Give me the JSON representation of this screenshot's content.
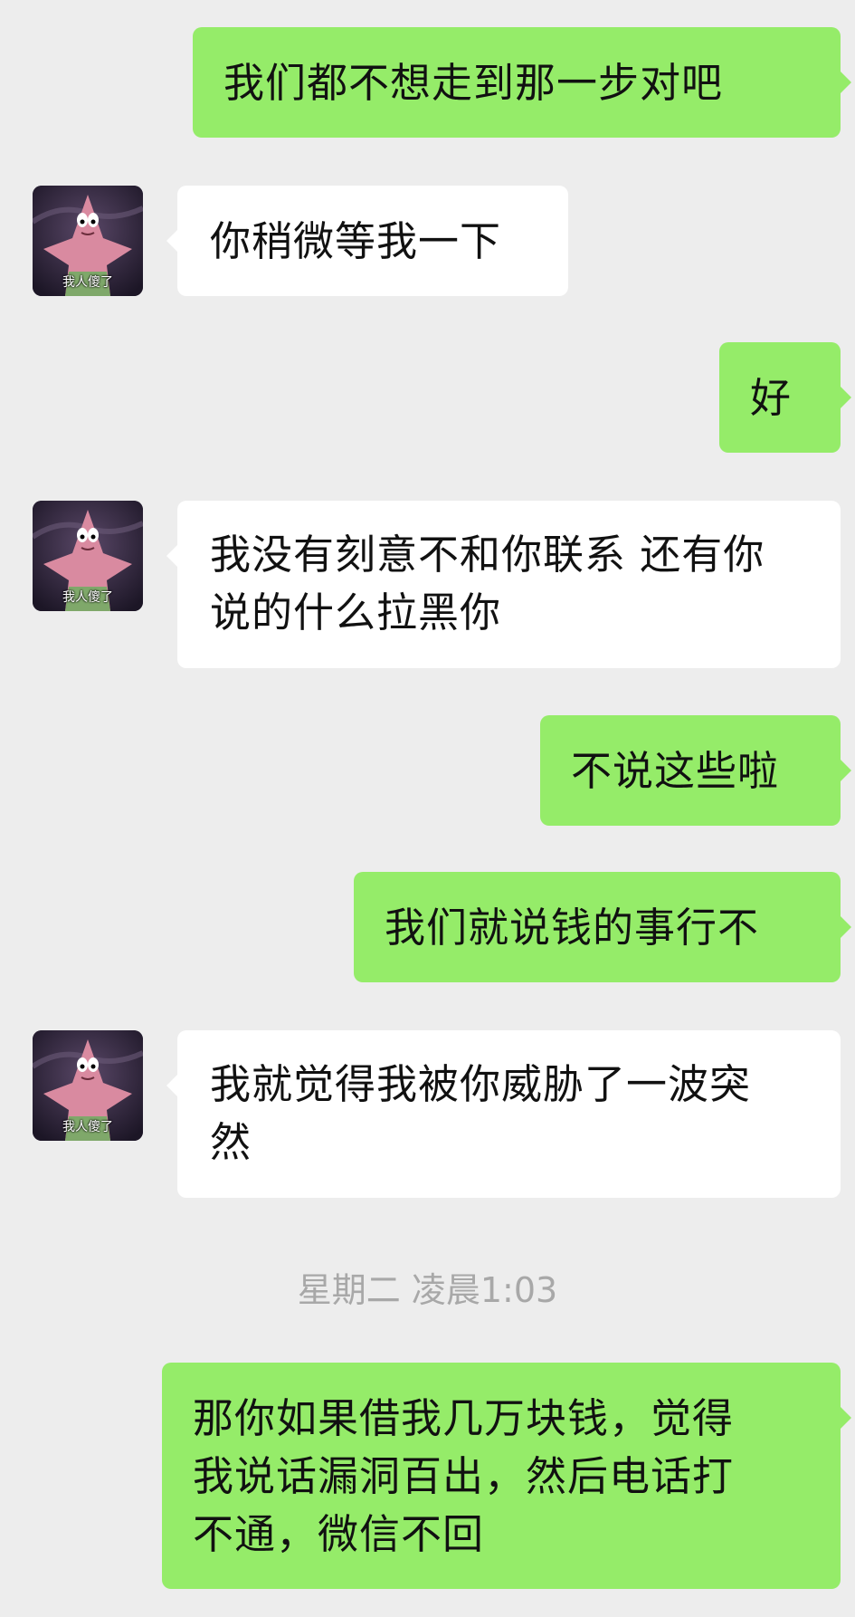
{
  "contact": {
    "avatar_caption": "我人傻了",
    "avatar_icon": "patrick-star-avatar-icon"
  },
  "messages": [
    {
      "side": "out",
      "text": "我们都不想走到那一步对吧"
    },
    {
      "side": "in",
      "text": "你稍微等我一下"
    },
    {
      "side": "out",
      "text": "好"
    },
    {
      "side": "in",
      "lines": [
        "我没有刻意不和你联系 还有你",
        "说的什么拉黑你"
      ]
    },
    {
      "side": "out",
      "text": "不说这些啦"
    },
    {
      "side": "out",
      "text": "我们就说钱的事行不"
    },
    {
      "side": "in",
      "lines": [
        "我就觉得我被你威胁了一波突",
        "然"
      ]
    },
    {
      "side": "out",
      "lines": [
        "那你如果借我几万块钱，觉得",
        "我说话漏洞百出，然后电话打",
        "不通，微信不回"
      ]
    }
  ],
  "timestamp": "星期二 凌晨1:03",
  "colors": {
    "background": "#ededed",
    "outgoing_bubble": "#95ec69",
    "incoming_bubble": "#ffffff",
    "timestamp_text": "#a8a8a8"
  }
}
